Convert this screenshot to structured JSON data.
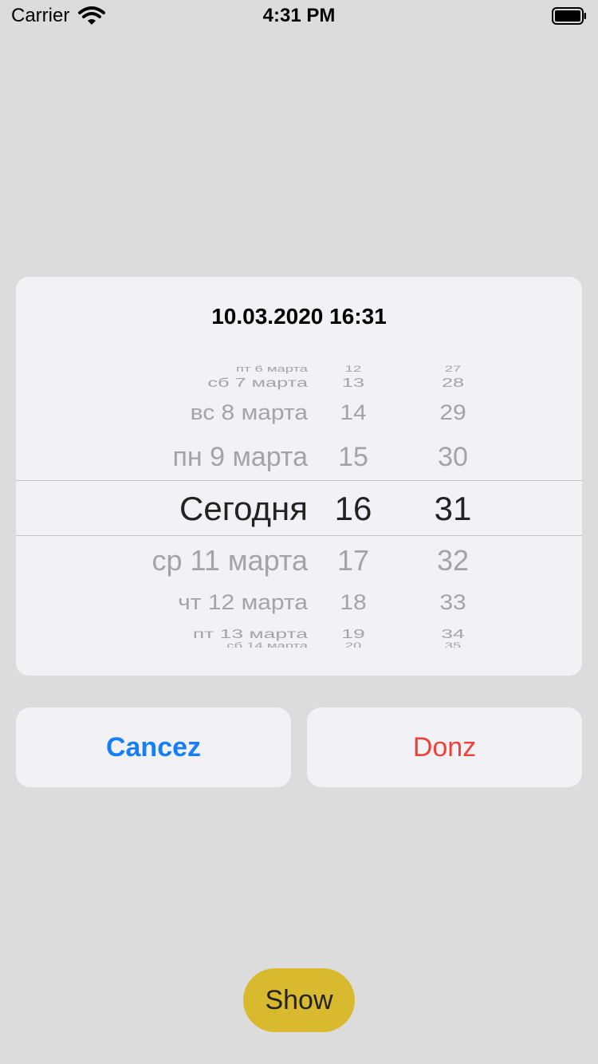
{
  "status_bar": {
    "carrier": "Carrier",
    "time": "4:31 PM",
    "wifi_icon": "wifi-icon",
    "battery_icon": "battery-icon"
  },
  "picker": {
    "title": "10.03.2020 16:31",
    "dates": [
      "пт 6 марта",
      "сб 7 марта",
      "вс 8 марта",
      "пн 9 марта",
      "Сегодня",
      "ср 11 марта",
      "чт 12 марта",
      "пт 13 марта",
      "сб 14 марта"
    ],
    "hours": [
      "12",
      "13",
      "14",
      "15",
      "16",
      "17",
      "18",
      "19",
      "20"
    ],
    "minutes": [
      "27",
      "28",
      "29",
      "30",
      "31",
      "32",
      "33",
      "34",
      "35"
    ],
    "selected_index": 4
  },
  "buttons": {
    "cancel": "Cancez",
    "done": "Donz",
    "show": "Show"
  },
  "colors": {
    "background": "#dcdcdc",
    "card": "#f2f2f6",
    "cancel": "#147efb",
    "done": "#f0403a",
    "show": "#d9b92e"
  }
}
